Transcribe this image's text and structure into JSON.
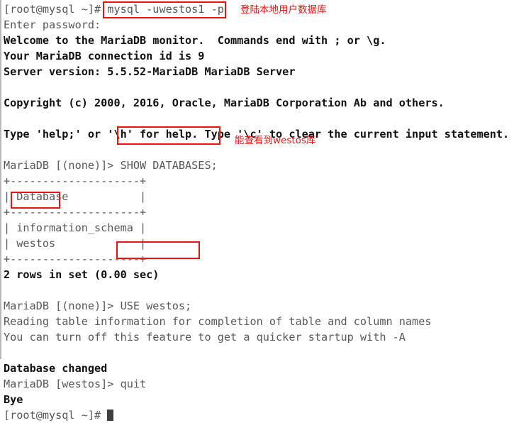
{
  "terminal": {
    "prompt_user_host": "[root@mysql ~]#",
    "lines": [
      {
        "id": "l01",
        "text": "[root@mysql ~]# mysql -uwestos1 -p",
        "bold": false
      },
      {
        "id": "l02",
        "text": "Enter password:",
        "bold": false
      },
      {
        "id": "l03",
        "text": "Welcome to the MariaDB monitor.  Commands end with ; or \\g.",
        "bold": true
      },
      {
        "id": "l04",
        "text": "Your MariaDB connection id is 9",
        "bold": true
      },
      {
        "id": "l05",
        "text": "Server version: 5.5.52-MariaDB MariaDB Server",
        "bold": true
      },
      {
        "id": "l06",
        "text": " ",
        "bold": false
      },
      {
        "id": "l07",
        "text": "Copyright (c) 2000, 2016, Oracle, MariaDB Corporation Ab and others.",
        "bold": true
      },
      {
        "id": "l08",
        "text": " ",
        "bold": false
      },
      {
        "id": "l09",
        "text": "Type 'help;' or '\\h' for help. Type '\\c' to clear the current input statement.",
        "bold": true
      },
      {
        "id": "l10",
        "text": " ",
        "bold": false
      },
      {
        "id": "l11",
        "text": "MariaDB [(none)]> SHOW DATABASES;",
        "bold": false
      },
      {
        "id": "l12",
        "text": "+--------------------+",
        "bold": false
      },
      {
        "id": "l13",
        "text": "| Database           |",
        "bold": false
      },
      {
        "id": "l14",
        "text": "+--------------------+",
        "bold": false
      },
      {
        "id": "l15",
        "text": "| information_schema |",
        "bold": false
      },
      {
        "id": "l16",
        "text": "| westos             |",
        "bold": false
      },
      {
        "id": "l17",
        "text": "+--------------------+",
        "bold": false
      },
      {
        "id": "l18",
        "text": "2 rows in set (0.00 sec)",
        "bold": true
      },
      {
        "id": "l19",
        "text": " ",
        "bold": false
      },
      {
        "id": "l20",
        "text": "MariaDB [(none)]> USE westos;",
        "bold": false
      },
      {
        "id": "l21",
        "text": "Reading table information for completion of table and column names",
        "bold": false
      },
      {
        "id": "l22",
        "text": "You can turn off this feature to get a quicker startup with -A",
        "bold": false
      },
      {
        "id": "l23",
        "text": " ",
        "bold": false
      },
      {
        "id": "l24",
        "text": "Database changed",
        "bold": true
      },
      {
        "id": "l25",
        "text": "MariaDB [westos]> quit",
        "bold": false
      },
      {
        "id": "l26",
        "text": "Bye",
        "bold": true
      },
      {
        "id": "l27",
        "text": "[root@mysql ~]# ",
        "bold": false
      }
    ],
    "commands": {
      "login": "mysql -uwestos1 -p",
      "show_databases": "SHOW DATABASES;",
      "use_westos": "USE westos;",
      "quit": "quit"
    },
    "database_table": {
      "header": "Database",
      "rows": [
        "information_schema",
        "westos"
      ],
      "row_count_text": "2 rows in set (0.00 sec)"
    }
  },
  "annotations": [
    {
      "id": "a1",
      "text": "登陆本地用户数据库"
    },
    {
      "id": "a2",
      "text": "能查看到westos库"
    }
  ],
  "colors": {
    "annotation_red": "#f01414",
    "highlight_box": "#ee1111",
    "text": "#585858",
    "bold_text": "#111111",
    "background": "#ffffff",
    "cursor": "#3c4043"
  }
}
